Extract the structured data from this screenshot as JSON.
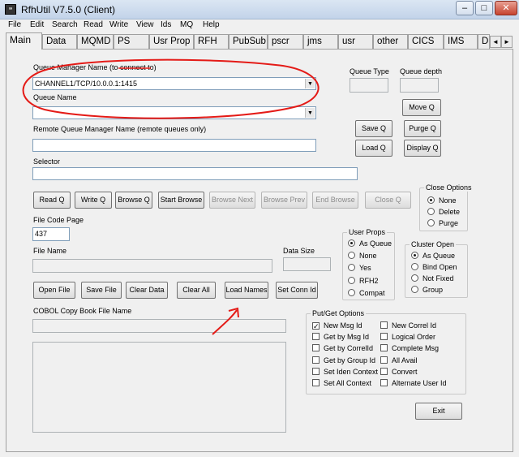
{
  "window": {
    "title": "RfhUtil V7.5.0 (Client)",
    "minimize": "–",
    "maximize": "□",
    "close": "✕"
  },
  "menu": [
    "File",
    "Edit",
    "Search",
    "Read",
    "Write",
    "View",
    "Ids",
    "MQ",
    "Help"
  ],
  "tabs": [
    "Main",
    "Data",
    "MQMD",
    "PS",
    "Usr Prop",
    "RFH",
    "PubSub",
    "pscr",
    "jms",
    "usr",
    "other",
    "CICS",
    "IMS",
    "D"
  ],
  "tab_scroll": {
    "left": "◄",
    "right": "►"
  },
  "main": {
    "qm_label": "Queue Manager Name (to connect to)",
    "qm_value": "CHANNEL1/TCP/10.0.0.1:1415",
    "queue_label": "Queue Name",
    "queue_value": "",
    "remote_qm_label": "Remote Queue Manager Name (remote queues only)",
    "selector_label": "Selector",
    "queue_type_label": "Queue Type",
    "queue_depth_label": "Queue depth",
    "code_page_label": "File Code Page",
    "code_page_value": "437",
    "file_name_label": "File Name",
    "data_size_label": "Data Size",
    "cobol_label": "COBOL Copy Book File Name"
  },
  "buttons": {
    "move_q": "Move Q",
    "save_q": "Save Q",
    "purge_q": "Purge Q",
    "load_q": "Load Q",
    "display_q": "Display Q",
    "read_q": "Read Q",
    "write_q": "Write Q",
    "browse_q": "Browse Q",
    "start_browse": "Start Browse",
    "browse_next": "Browse Next",
    "browse_prev": "Browse Prev",
    "end_browse": "End Browse",
    "close_q": "Close Q",
    "open_file": "Open File",
    "save_file": "Save File",
    "clear_data": "Clear Data",
    "clear_all": "Clear All",
    "load_names": "Load Names",
    "set_conn_id": "Set Conn Id",
    "exit": "Exit"
  },
  "close_options": {
    "title": "Close Options",
    "items": [
      "None",
      "Delete",
      "Purge"
    ],
    "selected": "None"
  },
  "user_props": {
    "title": "User Props",
    "items": [
      "As Queue",
      "None",
      "Yes",
      "RFH2",
      "Compat"
    ],
    "selected": "As Queue"
  },
  "cluster_open": {
    "title": "Cluster Open",
    "items": [
      "As Queue",
      "Bind Open",
      "Not Fixed",
      "Group"
    ],
    "selected": "As Queue"
  },
  "put_get": {
    "title": "Put/Get Options",
    "left": [
      {
        "label": "New Msg Id",
        "checked": true
      },
      {
        "label": "Get by Msg Id",
        "checked": false
      },
      {
        "label": "Get by CorrelId",
        "checked": false
      },
      {
        "label": "Get by Group Id",
        "checked": false
      },
      {
        "label": "Set Iden Context",
        "checked": false
      },
      {
        "label": "Set All Context",
        "checked": false
      }
    ],
    "right": [
      {
        "label": "New Correl Id",
        "checked": false
      },
      {
        "label": "Logical Order",
        "checked": false
      },
      {
        "label": "Complete Msg",
        "checked": false
      },
      {
        "label": "All Avail",
        "checked": false
      },
      {
        "label": "Convert",
        "checked": false
      },
      {
        "label": "Alternate User Id",
        "checked": false
      }
    ]
  },
  "colors": {
    "annotation": "#e41b17",
    "field_border": "#7f9db9"
  }
}
